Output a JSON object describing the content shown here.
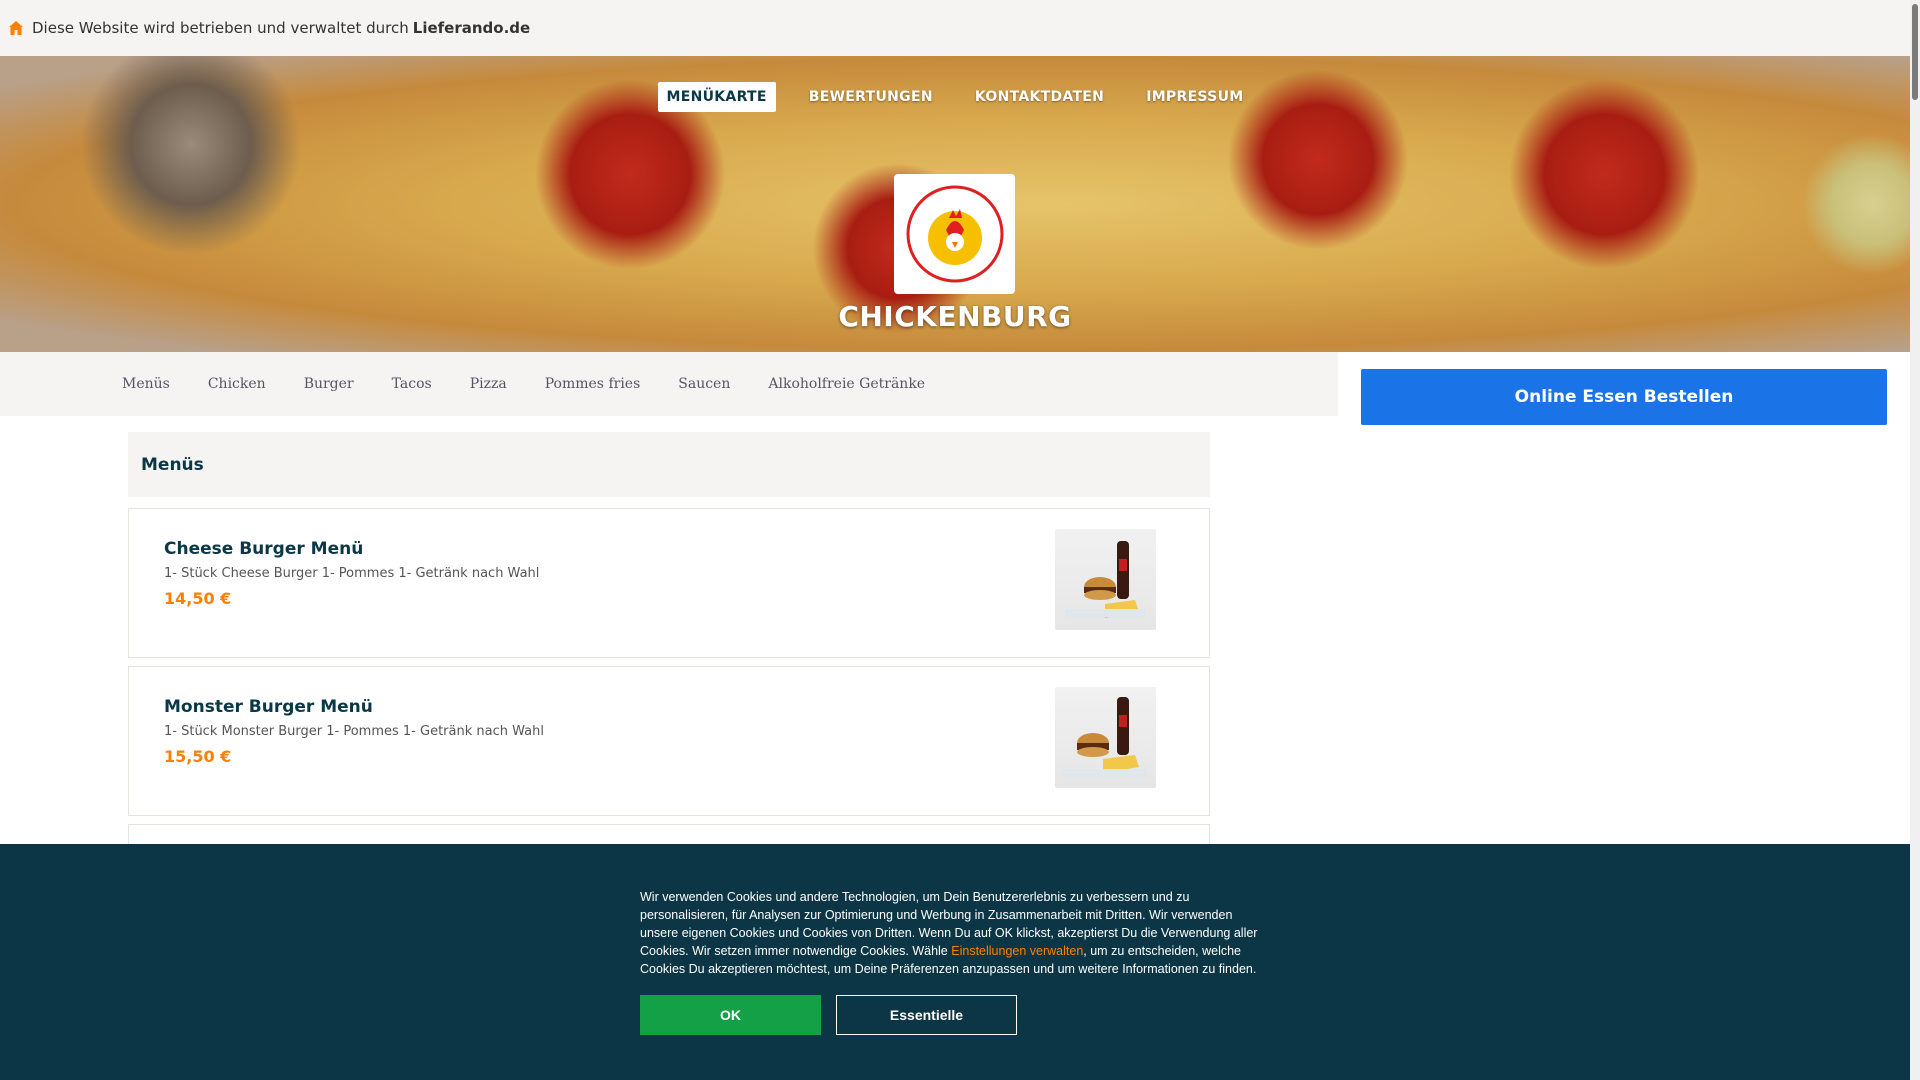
{
  "topbar": {
    "icon": "home-icon",
    "text": "Diese Website wird betrieben und verwaltet durch",
    "link": "Lieferando.de"
  },
  "hero": {
    "nav": [
      "MENÜKARTE",
      "BEWERTUNGEN",
      "KONTAKTDATEN",
      "IMPRESSUM"
    ],
    "active_nav": "MENÜKARTE",
    "logo_text": "CHICKENBURG",
    "brand": "CHICKENBURG"
  },
  "categories": [
    "Menüs",
    "Chicken",
    "Burger",
    "Tacos",
    "Pizza",
    "Pommes fries",
    "Saucen",
    "Alkoholfreie Getränke"
  ],
  "order_button": "Online Essen Bestellen",
  "section": {
    "title": "Menüs",
    "items": [
      {
        "name": "Cheese Burger Menü",
        "desc": "1- Stück Cheese Burger 1- Pommes 1- Getränk nach Wahl",
        "price": "14,50 €"
      },
      {
        "name": "Monster Burger Menü",
        "desc": "1- Stück Monster Burger 1- Pommes 1- Getränk nach Wahl",
        "price": "15,50 €"
      }
    ]
  },
  "cookie": {
    "text_before": "Wir verwenden Cookies und andere Technologien, um Dein Benutzererlebnis zu verbessern und zu personalisieren, für Analysen zur Optimierung und Werbung in Zusammenarbeit mit Dritten. Wir verwenden unsere eigenen Cookies und Cookies von Dritten. Wenn Du auf OK klickst, akzeptierst Du die Verwendung aller Cookies. Wir setzen immer notwendige Cookies. Wähle",
    "link": "Einstellungen verwalten",
    "text_after": ", um zu entscheiden, welche Cookies Du akzeptieren möchtest, um Deine Präferenzen anzupassen und um weitere Informationen zu finden.",
    "ok": "OK",
    "essential": "Essentielle"
  },
  "colors": {
    "accent": "#ff8000",
    "primary": "#1a74e8",
    "banner": "#0c3645",
    "ok": "#14a046"
  }
}
